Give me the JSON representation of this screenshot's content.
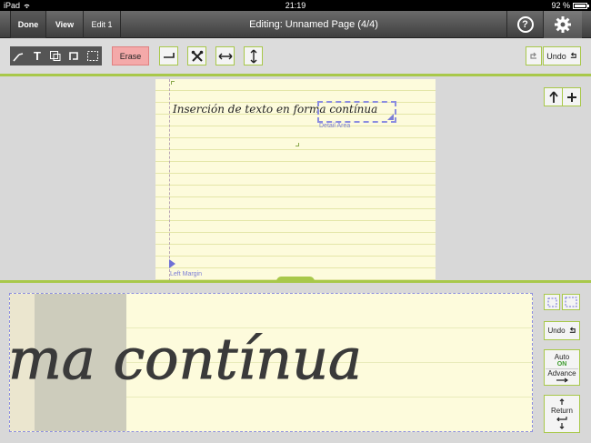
{
  "status_bar": {
    "carrier": "iPad",
    "time": "21:19",
    "battery": "92 %"
  },
  "nav": {
    "done_label": "Done",
    "view_label": "View",
    "edit_label": "Edit 1",
    "title": "Editing: Unnamed Page (4/4)"
  },
  "toolbar": {
    "erase_label": "Erase",
    "undo_label": "Undo"
  },
  "page": {
    "text": "Inserción de texto en forma contínua",
    "detail_label": "Detail Area",
    "margin_label": "Left Margin"
  },
  "writing": {
    "text": "ma contínua",
    "undo_label": "Undo",
    "auto_label": "Auto",
    "auto_state": "ON",
    "advance_label": "Advance",
    "return_label": "Return"
  },
  "colors": {
    "accent": "#a8c84a",
    "erase": "#f4a9a9",
    "guide": "#8b8de0",
    "paper": "#fdfbdc"
  }
}
